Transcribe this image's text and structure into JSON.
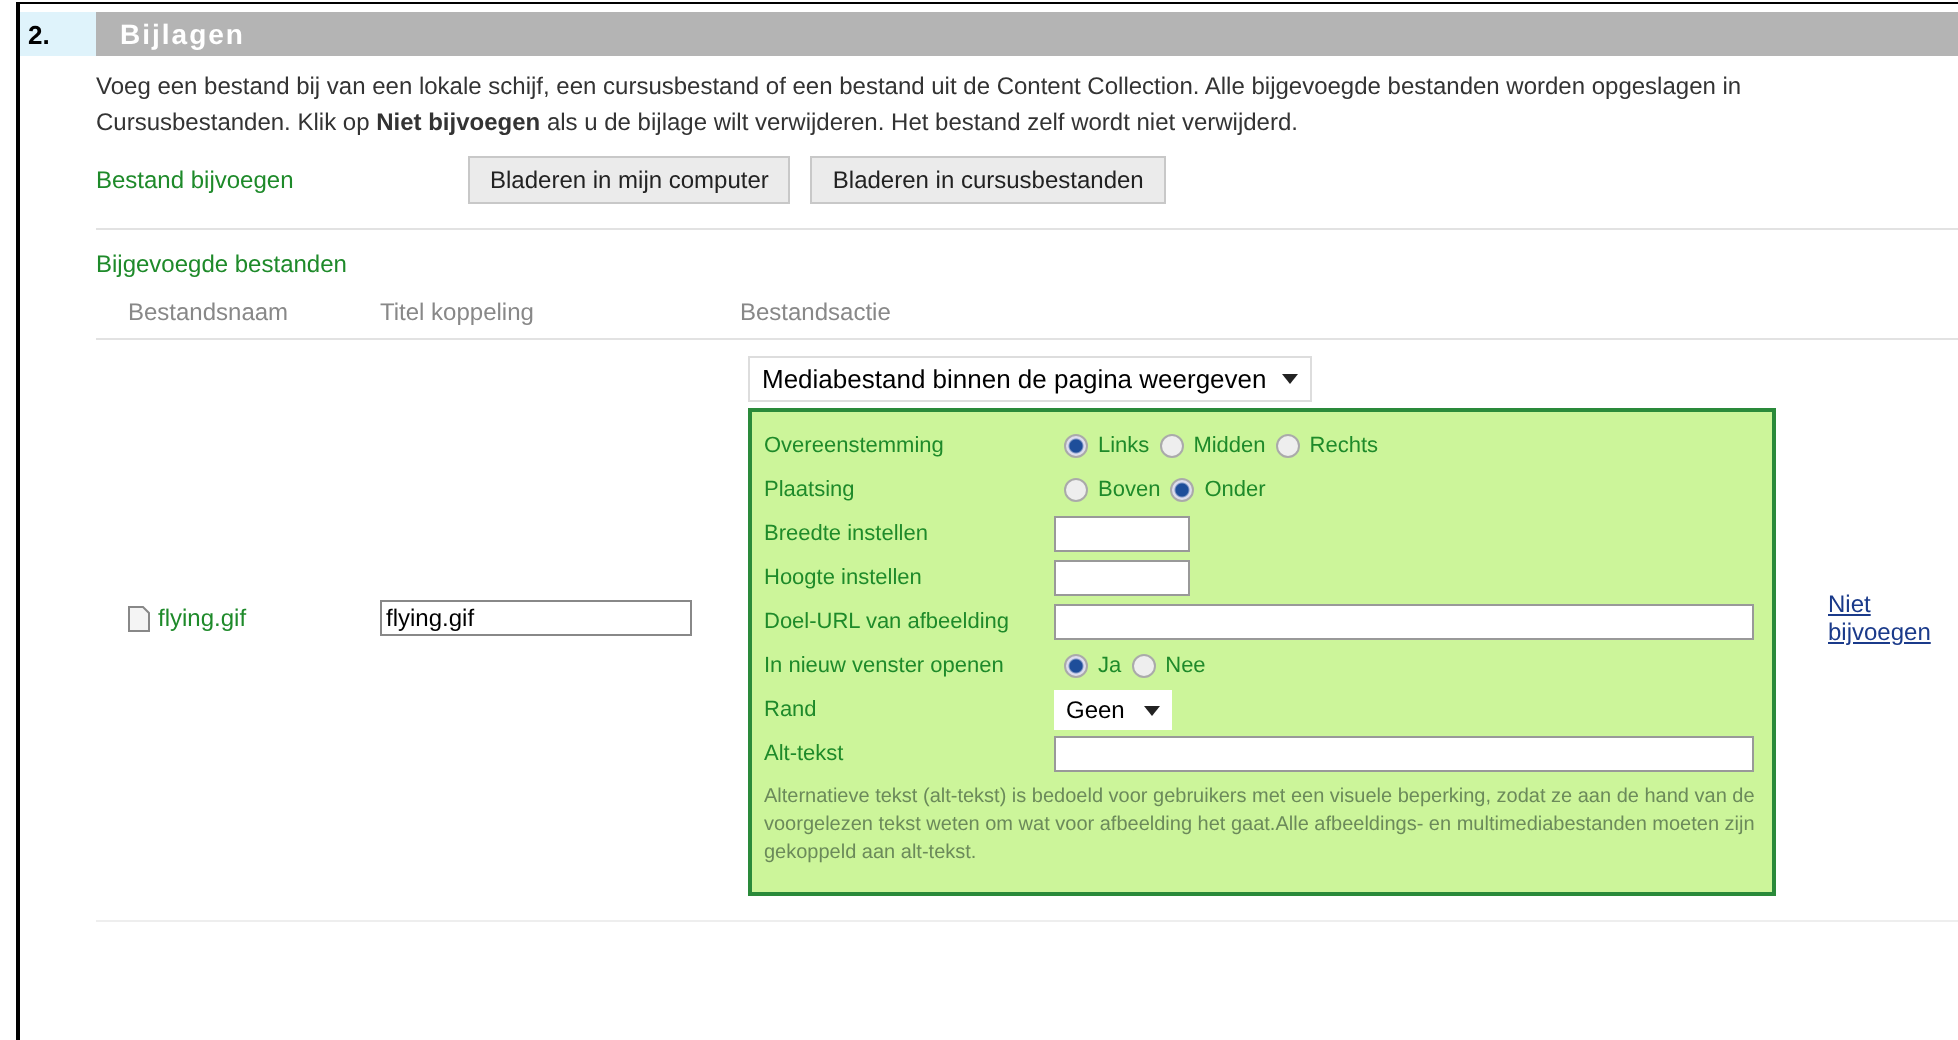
{
  "section": {
    "number": "2.",
    "title": "Bijlagen"
  },
  "description": "Voeg een bestand bij van een lokale schijf, een cursusbestand of een bestand uit de Content Collection. Alle bijgevoegde bestanden worden opgeslagen in Cursusbestanden. Klik op **Niet bijvoegen** als u de bijlage wilt verwijderen. Het bestand zelf wordt niet verwijderd.",
  "attach": {
    "label": "Bestand bijvoegen",
    "buttons": [
      "Bladeren in mijn computer",
      "Bladeren in cursusbestanden"
    ]
  },
  "attached": {
    "heading": "Bijgevoegde bestanden",
    "columns": [
      "Bestandsnaam",
      "Titel koppeling",
      "Bestandsactie"
    ]
  },
  "file": {
    "name": "flying.gif",
    "link_title": "flying.gif",
    "action": "Mediabestand binnen de pagina weergeven",
    "remove_link": "Niet bijvoegen"
  },
  "options": [
    {
      "kind": "radio",
      "label": "Overeenstemming",
      "choices": [
        {
          "label": "Links",
          "selected": true
        },
        {
          "label": "Midden",
          "selected": false
        },
        {
          "label": "Rechts",
          "selected": false
        }
      ]
    },
    {
      "kind": "radio",
      "label": "Plaatsing",
      "choices": [
        {
          "label": "Boven",
          "selected": false
        },
        {
          "label": "Onder",
          "selected": true
        }
      ]
    },
    {
      "kind": "short-input",
      "label": "Breedte instellen"
    },
    {
      "kind": "short-input",
      "label": "Hoogte instellen"
    },
    {
      "kind": "long-input",
      "label": "Doel-URL van afbeelding"
    },
    {
      "kind": "radio",
      "label": "In nieuw venster openen",
      "choices": [
        {
          "label": "Ja",
          "selected": true
        },
        {
          "label": "Nee",
          "selected": false
        }
      ]
    },
    {
      "kind": "select",
      "label": "Rand",
      "value": "Geen"
    },
    {
      "kind": "long-input",
      "label": "Alt-tekst"
    }
  ],
  "help": "Alternatieve tekst (alt-tekst) is bedoeld voor gebruikers met een visuele beperking, zodat ze aan de hand van de voorgelezen tekst weten om wat voor afbeelding het gaat.Alle afbeeldings- en multimediabestanden moeten zijn gekoppeld aan alt-tekst."
}
